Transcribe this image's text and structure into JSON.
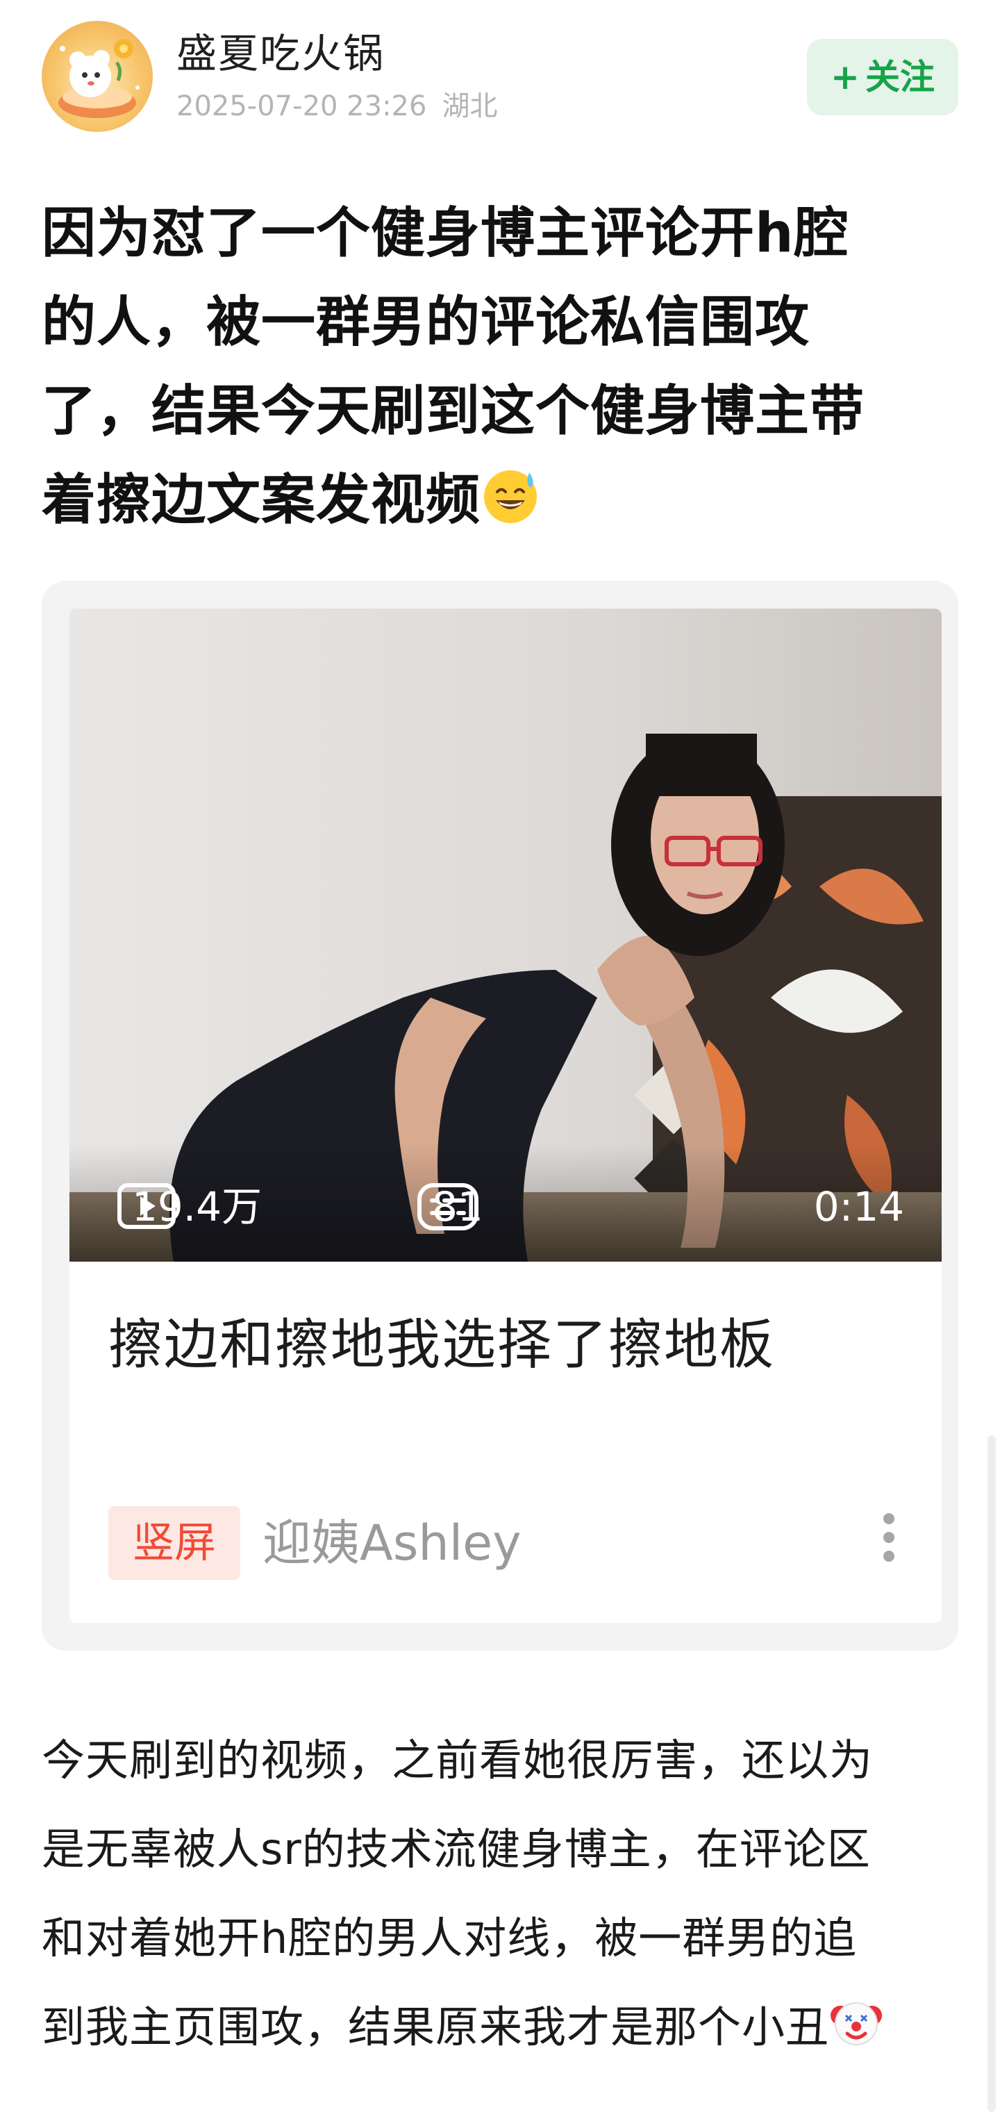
{
  "author": {
    "name": "盛夏吃火锅",
    "timestamp": "2025-07-20 23:26",
    "location": "湖北"
  },
  "follow_button": {
    "plus": "+",
    "label": "关注"
  },
  "post": {
    "title_line1": "因为怼了一个健身博主评论开h腔",
    "title_line2": "的人，被一群男的评论私信围攻",
    "title_line3": "了，结果今天刷到这个健身博主带",
    "title_line4": "着擦边文案发视频",
    "title_emoji": "sweat-smile-emoji"
  },
  "video_card": {
    "views": "19.4万",
    "comments": "81",
    "duration": "0:14",
    "title": "擦边和擦地我选择了擦地板",
    "tag": "竖屏",
    "channel": "迎姨Ashley",
    "more_icon": "more-vertical-icon"
  },
  "body": {
    "line1": "今天刷到的视频，之前看她很厉害，还以为",
    "line2": "是无辜被人sr的技术流健身博主，在评论区",
    "line3": "和对着她开h腔的男人对线，被一群男的追",
    "line4": "到我主页围攻，结果原来我才是那个小丑",
    "end_emoji": "clown-face-emoji"
  },
  "colors": {
    "follow_bg": "#e4f4e8",
    "follow_text": "#17a34a",
    "tag_bg": "#fde8e4",
    "tag_text": "#f04b35",
    "meta_text": "#b4b4b4"
  }
}
